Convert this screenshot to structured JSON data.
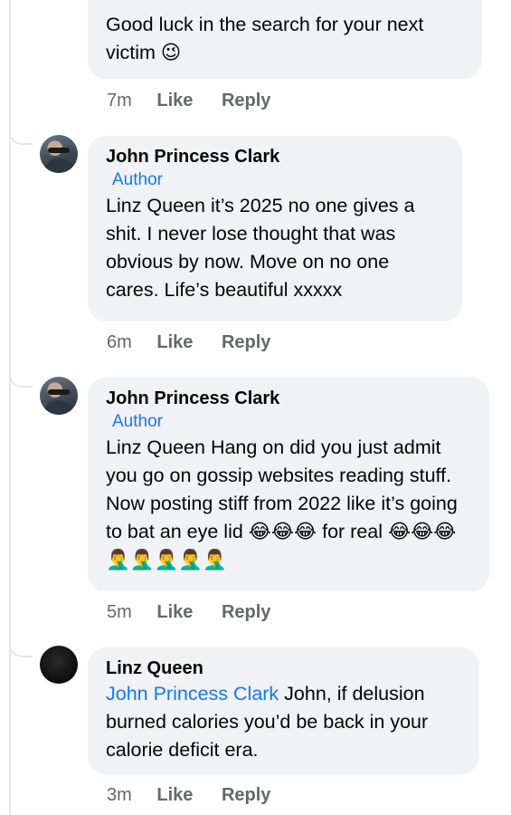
{
  "comments": [
    {
      "author": "",
      "badge": "",
      "text": "Good luck in the search for your next victim 😉",
      "time": "7m",
      "like_label": "Like",
      "reply_label": "Reply"
    },
    {
      "author": "John Princess Clark",
      "badge": "Author",
      "text": "Linz Queen it’s 2025 no one gives a shit. I never lose thought that was obvious by now. Move on no one cares. Life’s beautiful xxxxx",
      "time": "6m",
      "like_label": "Like",
      "reply_label": "Reply"
    },
    {
      "author": "John Princess Clark",
      "badge": "Author",
      "text": "Linz Queen Hang on did you just admit you go on gossip websites reading stuff. Now posting stiff from 2022 like it’s going to bat an eye lid 😂😂😂 for real 😂😂😂🤦‍♂️🤦‍♂️🤦‍♂️🤦‍♂️🤦‍♂️",
      "time": "5m",
      "like_label": "Like",
      "reply_label": "Reply"
    },
    {
      "author": "Linz Queen",
      "badge": "",
      "mention": "John Princess Clark",
      "text": " John, if delusion burned calories you’d be back in your calorie deficit era.",
      "time": "3m",
      "like_label": "Like",
      "reply_label": "Reply"
    }
  ],
  "icons": {
    "avatar_john": "profile-photo-avatar",
    "avatar_linz": "dark-avatar"
  }
}
